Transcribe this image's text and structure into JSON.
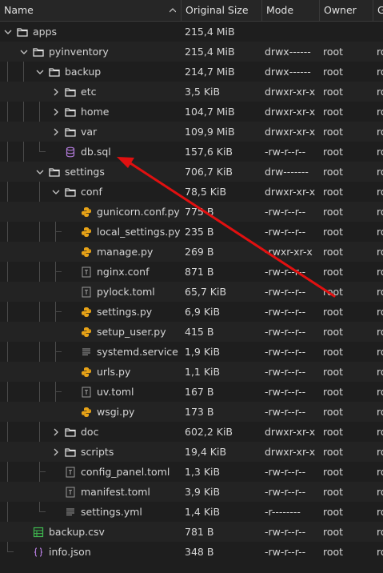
{
  "header": {
    "name": "Name",
    "size": "Original Size",
    "mode": "Mode",
    "owner": "Owner",
    "group": "G"
  },
  "rows": [
    {
      "name": "apps",
      "size": "215,4 MiB",
      "mode": "",
      "owner": "",
      "group": "",
      "type": "folder",
      "depth": 0,
      "expanded": true
    },
    {
      "name": "pyinventory",
      "size": "215,4 MiB",
      "mode": "drwx------",
      "owner": "root",
      "group": "ro",
      "type": "folder",
      "depth": 1,
      "expanded": true
    },
    {
      "name": "backup",
      "size": "214,7 MiB",
      "mode": "drwx------",
      "owner": "root",
      "group": "ro",
      "type": "folder",
      "depth": 2,
      "expanded": true
    },
    {
      "name": "etc",
      "size": "3,5 KiB",
      "mode": "drwxr-xr-x",
      "owner": "root",
      "group": "ro",
      "type": "folder",
      "depth": 3,
      "expanded": false
    },
    {
      "name": "home",
      "size": "104,7 MiB",
      "mode": "drwxr-xr-x",
      "owner": "root",
      "group": "ro",
      "type": "folder",
      "depth": 3,
      "expanded": false
    },
    {
      "name": "var",
      "size": "109,9 MiB",
      "mode": "drwxr-xr-x",
      "owner": "root",
      "group": "ro",
      "type": "folder",
      "depth": 3,
      "expanded": false
    },
    {
      "name": "db.sql",
      "size": "157,6 KiB",
      "mode": "-rw-r--r--",
      "owner": "root",
      "group": "ro",
      "type": "db",
      "depth": 3
    },
    {
      "name": "settings",
      "size": "706,7 KiB",
      "mode": "drw-------",
      "owner": "root",
      "group": "ro",
      "type": "folder",
      "depth": 2,
      "expanded": true
    },
    {
      "name": "conf",
      "size": "78,5 KiB",
      "mode": "drwxr-xr-x",
      "owner": "root",
      "group": "ro",
      "type": "folder",
      "depth": 3,
      "expanded": true
    },
    {
      "name": "gunicorn.conf.py",
      "size": "775 B",
      "mode": "-rw-r--r--",
      "owner": "root",
      "group": "ro",
      "type": "python",
      "depth": 4
    },
    {
      "name": "local_settings.py",
      "size": "235 B",
      "mode": "-rw-r--r--",
      "owner": "root",
      "group": "ro",
      "type": "python",
      "depth": 4
    },
    {
      "name": "manage.py",
      "size": "269 B",
      "mode": "-rwxr-xr-x",
      "owner": "root",
      "group": "ro",
      "type": "python",
      "depth": 4
    },
    {
      "name": "nginx.conf",
      "size": "871 B",
      "mode": "-rw-r--r--",
      "owner": "root",
      "group": "ro",
      "type": "text",
      "depth": 4
    },
    {
      "name": "pylock.toml",
      "size": "65,7 KiB",
      "mode": "-rw-r--r--",
      "owner": "root",
      "group": "ro",
      "type": "toml",
      "depth": 4
    },
    {
      "name": "settings.py",
      "size": "6,9 KiB",
      "mode": "-rw-r--r--",
      "owner": "root",
      "group": "ro",
      "type": "python",
      "depth": 4
    },
    {
      "name": "setup_user.py",
      "size": "415 B",
      "mode": "-rw-r--r--",
      "owner": "root",
      "group": "ro",
      "type": "python",
      "depth": 4
    },
    {
      "name": "systemd.service",
      "size": "1,9 KiB",
      "mode": "-rw-r--r--",
      "owner": "root",
      "group": "ro",
      "type": "lines",
      "depth": 4
    },
    {
      "name": "urls.py",
      "size": "1,1 KiB",
      "mode": "-rw-r--r--",
      "owner": "root",
      "group": "ro",
      "type": "python",
      "depth": 4
    },
    {
      "name": "uv.toml",
      "size": "167 B",
      "mode": "-rw-r--r--",
      "owner": "root",
      "group": "ro",
      "type": "toml",
      "depth": 4
    },
    {
      "name": "wsgi.py",
      "size": "173 B",
      "mode": "-rw-r--r--",
      "owner": "root",
      "group": "ro",
      "type": "python",
      "depth": 4
    },
    {
      "name": "doc",
      "size": "602,2 KiB",
      "mode": "drwxr-xr-x",
      "owner": "root",
      "group": "ro",
      "type": "folder",
      "depth": 3,
      "expanded": false
    },
    {
      "name": "scripts",
      "size": "19,4 KiB",
      "mode": "drwxr-xr-x",
      "owner": "root",
      "group": "ro",
      "type": "folder",
      "depth": 3,
      "expanded": false
    },
    {
      "name": "config_panel.toml",
      "size": "1,3 KiB",
      "mode": "-rw-r--r--",
      "owner": "root",
      "group": "ro",
      "type": "toml",
      "depth": 3
    },
    {
      "name": "manifest.toml",
      "size": "3,9 KiB",
      "mode": "-rw-r--r--",
      "owner": "root",
      "group": "ro",
      "type": "toml",
      "depth": 3
    },
    {
      "name": "settings.yml",
      "size": "1,4 KiB",
      "mode": "-r--------",
      "owner": "root",
      "group": "ro",
      "type": "lines",
      "depth": 3
    },
    {
      "name": "backup.csv",
      "size": "781 B",
      "mode": "-rw-r--r--",
      "owner": "root",
      "group": "ro",
      "type": "csv",
      "depth": 1
    },
    {
      "name": "info.json",
      "size": "348 B",
      "mode": "-rw-r--r--",
      "owner": "root",
      "group": "ro",
      "type": "json",
      "depth": 1
    }
  ],
  "colors": {
    "background": "#1e1e1e",
    "text": "#d4d4d4",
    "python_icon": "#e8a317",
    "db_icon": "#b07ad8",
    "csv_icon": "#3fb950",
    "json_icon": "#b07ad8",
    "annotation_arrow": "#e01010"
  },
  "annotation": {
    "type": "arrow",
    "points_to": "db.sql"
  }
}
